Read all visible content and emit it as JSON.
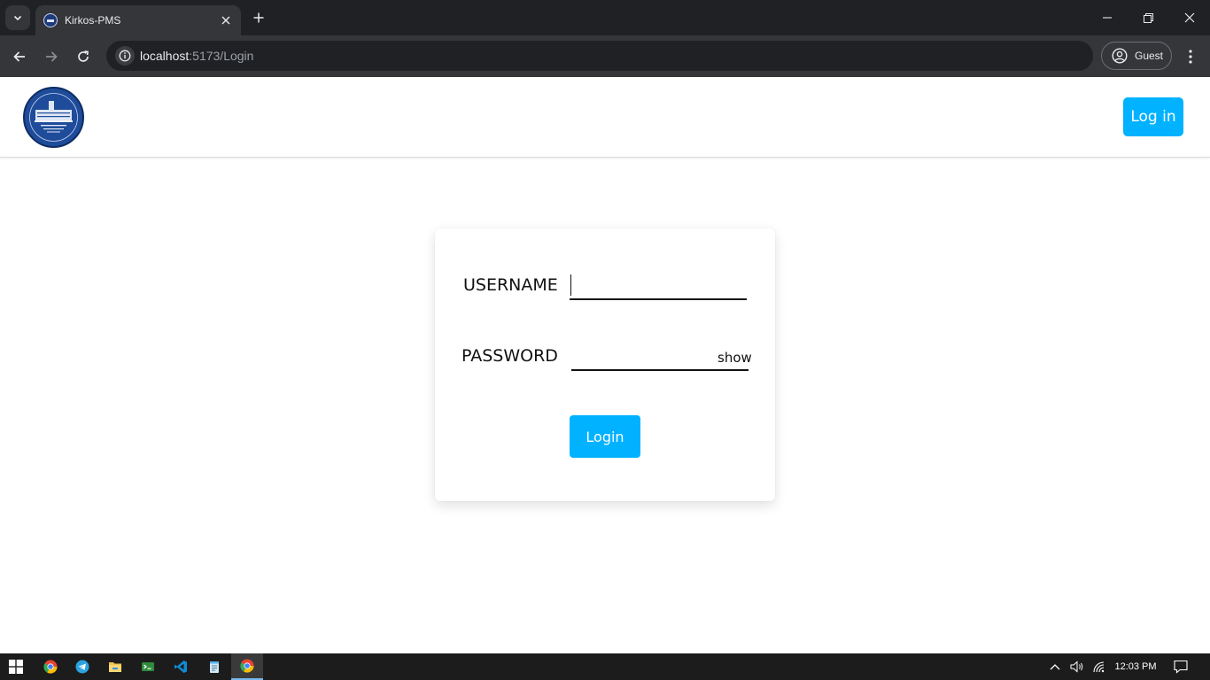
{
  "browser": {
    "tab_title": "Kirkos-PMS",
    "url_host": "localhost",
    "url_path": ":5173/Login",
    "profile_label": "Guest"
  },
  "header": {
    "logo_icon": "city-administration-seal-logo",
    "login_button_label": "Log in"
  },
  "login_form": {
    "username_label": "USERNAME",
    "username_value": "",
    "password_label": "PASSWORD",
    "password_value": "",
    "show_toggle_label": "show",
    "submit_label": "Login"
  },
  "colors": {
    "accent": "#00b2ff",
    "chrome_dark": "#202124",
    "chrome_toolbar": "#35363a",
    "taskbar": "#1c1c1c"
  },
  "taskbar": {
    "apps": [
      "start-icon",
      "chrome-icon",
      "telegram-icon",
      "file-explorer-icon",
      "terminal-icon",
      "vscode-icon",
      "notepad-icon",
      "chrome-active-icon"
    ],
    "clock": "12:03 PM"
  }
}
